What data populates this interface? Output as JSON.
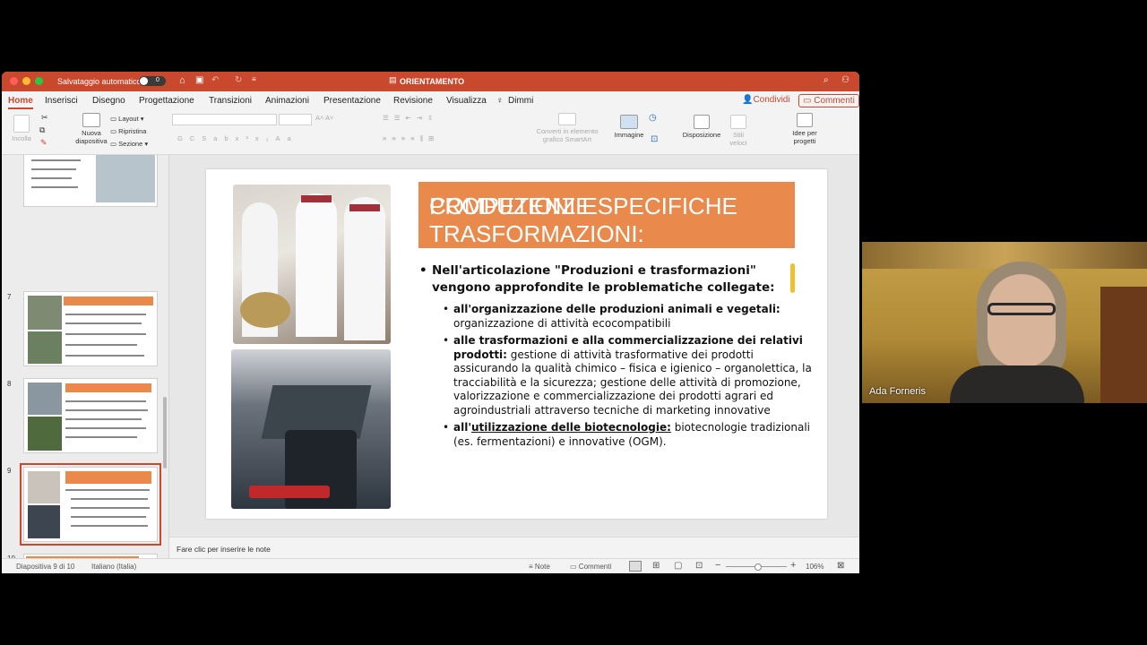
{
  "window": {
    "autosave_label": "Salvataggio automatico",
    "autosave_state": "0",
    "title": "ORIENTAMENTO"
  },
  "ribbon_tabs": [
    "Home",
    "Inserisci",
    "Disegno",
    "Progettazione",
    "Transizioni",
    "Animazioni",
    "Presentazione",
    "Revisione",
    "Visualizza",
    "Dimmi"
  ],
  "share": {
    "condividi": "Condividi",
    "commenti": "Commenti"
  },
  "ribbon": {
    "incolla": "Incolla",
    "nuova_diapositiva_1": "Nuova",
    "nuova_diapositiva_2": "diapositiva",
    "layout": "Layout",
    "ripristina": "Ripristina",
    "sezione": "Sezione",
    "smartart_1": "Converti in elemento",
    "smartart_2": "grafico SmartArt",
    "immagine": "Immagine",
    "disposizione": "Disposizione",
    "stili_1": "Stili",
    "stili_2": "veloci",
    "idee_1": "Idee per",
    "idee_2": "progetti"
  },
  "thumbnails": [
    {
      "number": "7",
      "title": "UNA SCELTA CHE NON DEVE SPAVENTARE PERCHÉ..."
    },
    {
      "number": "8",
      "title": "COSA OFFRE L'INDIRIZZO"
    },
    {
      "number": "9",
      "title": "PRODUZIONI E TRASFORMAZIONI: COMPETENZE SPECIFICHE"
    },
    {
      "number": "10",
      "title": "QUADRO ORARIO A CONFRONTO"
    }
  ],
  "slide": {
    "title_line1": "PRODUZIONI E TRASFORMAZIONI:",
    "title_line2": "COMPETENZE SPECIFICHE",
    "bullet_main": "Nell'articolazione \"Produzioni e trasformazioni\" vengono approfondite le problematiche collegate:",
    "b1_bold": "all'organizzazione delle produzioni animali e vegetali:",
    "b1_text": " organizzazione di attività ecocompatibili",
    "b2_bold": "alle trasformazioni e alla commercializzazione dei relativi prodotti:",
    "b2_text": " gestione di attività trasformative dei prodotti assicurando la qualità chimico – fisica e igienico – organolettica, la tracciabilità e la sicurezza; gestione delle attività di promozione, valorizzazione e commercializzazione dei prodotti agrari ed agroindustriali attraverso tecniche di marketing innovative",
    "b3_bold_plain": "all'",
    "b3_bold_underlined": "utilizzazione delle biotecnologie:",
    "b3_text": " biotecnologie tradizionali (es. fermentazioni) e innovative (OGM)."
  },
  "notes_placeholder": "Fare clic per inserire le note",
  "status": {
    "slide_counter": "Diapositiva 9 di 10",
    "language": "Italiano (Italia)",
    "note": "Note",
    "commenti": "Commenti",
    "zoom": "106%"
  },
  "video": {
    "participant_name": "Ada Forneris"
  }
}
